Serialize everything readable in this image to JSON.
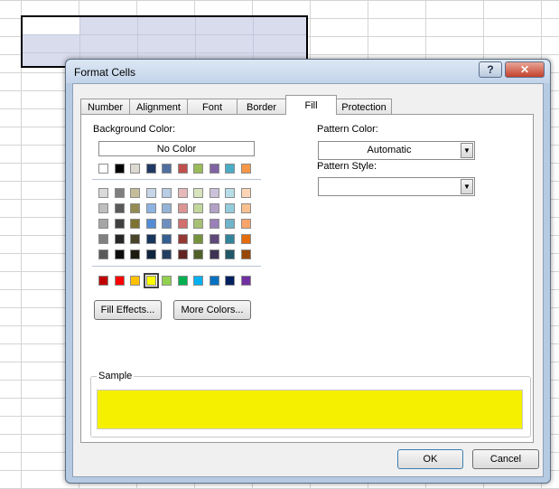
{
  "dialog": {
    "title": "Format Cells",
    "help_label": "?",
    "close_label": "✕",
    "tabs": [
      {
        "label": "Number",
        "active": false
      },
      {
        "label": "Alignment",
        "active": false
      },
      {
        "label": "Font",
        "active": false
      },
      {
        "label": "Border",
        "active": false
      },
      {
        "label": "Fill",
        "active": true
      },
      {
        "label": "Protection",
        "active": false
      }
    ],
    "fill": {
      "background_color_label": "Background Color:",
      "no_color_label": "No Color",
      "theme_row": [
        "#ffffff",
        "#000000",
        "#dcd9d0",
        "#1f3864",
        "#4f6f9f",
        "#c0504d",
        "#9bbb59",
        "#8064a2",
        "#4bacc6",
        "#f79646"
      ],
      "shade_rows": [
        [
          "#d9d9d9",
          "#7f7f7f",
          "#c4bd97",
          "#c6d5e8",
          "#b8cce4",
          "#e6b9b8",
          "#d7e4bc",
          "#ccc1da",
          "#b7dee8",
          "#fbd5b5"
        ],
        [
          "#bfbfbf",
          "#595959",
          "#948a54",
          "#8db3e2",
          "#95b3d7",
          "#d99694",
          "#c3d69b",
          "#b2a2c7",
          "#93cddd",
          "#fac08f"
        ],
        [
          "#a6a6a6",
          "#404040",
          "#7f7331",
          "#548dd4",
          "#6d8fbf",
          "#d06f6c",
          "#a6c174",
          "#9980b8",
          "#6fb4c8",
          "#f8a46a"
        ],
        [
          "#808080",
          "#262626",
          "#494429",
          "#17365d",
          "#365f91",
          "#953734",
          "#76923c",
          "#5f497a",
          "#31859b",
          "#e36c09"
        ],
        [
          "#595959",
          "#0d0d0d",
          "#1d1b10",
          "#0f243e",
          "#244061",
          "#632423",
          "#4f6128",
          "#3f3151",
          "#205867",
          "#974806"
        ]
      ],
      "standard_row": [
        "#c00000",
        "#ff0000",
        "#ffc000",
        "#ffff00",
        "#92d050",
        "#00b050",
        "#00b0f0",
        "#0070c0",
        "#002060",
        "#7030a0"
      ],
      "selected_color": "#ffff00",
      "fill_effects_label": "Fill Effects...",
      "more_colors_label": "More Colors...",
      "pattern_color_label": "Pattern Color:",
      "pattern_color_value": "Automatic",
      "pattern_style_label": "Pattern Style:",
      "pattern_style_value": "",
      "sample_label": "Sample",
      "sample_color": "#f5f000"
    },
    "ok_label": "OK",
    "cancel_label": "Cancel"
  }
}
